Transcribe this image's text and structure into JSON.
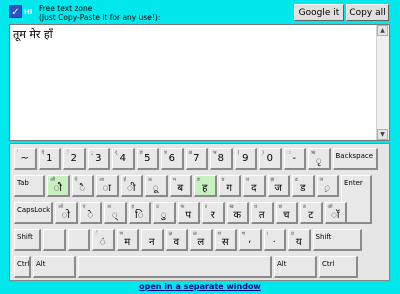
{
  "header": {
    "hi_label": "HI",
    "free_text_title": "Free text zone",
    "free_text_hint": "(Just Copy-Paste it for any use!):",
    "google_button": "Google it",
    "copy_button": "Copy all"
  },
  "editor": {
    "text": "तूम मेर हाँ"
  },
  "keyboard": {
    "rows": [
      [
        {
          "name": "key-grave",
          "sup": "'",
          "main": "~"
        },
        {
          "name": "key-1",
          "sup": "ऍ",
          "main": "1"
        },
        {
          "name": "key-2",
          "sup": "ॅ",
          "main": "2"
        },
        {
          "name": "key-3",
          "sup": "्र",
          "main": "3"
        },
        {
          "name": "key-4",
          "sup": "र्",
          "main": "4"
        },
        {
          "name": "key-5",
          "sup": "ज्ञ",
          "main": "5"
        },
        {
          "name": "key-6",
          "sup": "त्र",
          "main": "6"
        },
        {
          "name": "key-7",
          "sup": "क्ष",
          "main": "7"
        },
        {
          "name": "key-8",
          "sup": "श्र",
          "main": "8"
        },
        {
          "name": "key-9",
          "sup": "(",
          "main": "9"
        },
        {
          "name": "key-0",
          "sup": ")",
          "main": "0"
        },
        {
          "name": "key-minus",
          "sup": "ः",
          "main": "-"
        },
        {
          "name": "key-equals",
          "sup": "ऋ",
          "main": "ृ"
        },
        {
          "name": "key-backspace",
          "label": "Backspace"
        }
      ],
      [
        {
          "name": "key-tab",
          "label": "Tab"
        },
        {
          "name": "key-q",
          "sup": "औ",
          "main": "ौ",
          "hl": true
        },
        {
          "name": "key-w",
          "sup": "ऐ",
          "main": "ै"
        },
        {
          "name": "key-e",
          "sup": "आ",
          "main": "ा"
        },
        {
          "name": "key-r",
          "sup": "ई",
          "main": "ी"
        },
        {
          "name": "key-t",
          "sup": "ऊ",
          "main": "ू"
        },
        {
          "name": "key-y",
          "sup": "भ",
          "main": "ब"
        },
        {
          "name": "key-u",
          "sup": "ङ",
          "main": "ह",
          "hl": true
        },
        {
          "name": "key-i",
          "sup": "घ",
          "main": "ग"
        },
        {
          "name": "key-o",
          "sup": "ध",
          "main": "द"
        },
        {
          "name": "key-p",
          "sup": "झ",
          "main": "ज"
        },
        {
          "name": "key-bracket-left",
          "sup": "ढ",
          "main": "ड"
        },
        {
          "name": "key-bracket-right",
          "sup": "ञ",
          "main": "़"
        },
        {
          "name": "key-enter",
          "label": "Enter"
        }
      ],
      [
        {
          "name": "key-capslock",
          "label": "CapsLock"
        },
        {
          "name": "key-a",
          "sup": "ओ",
          "main": "ो"
        },
        {
          "name": "key-s",
          "sup": "ए",
          "main": "े"
        },
        {
          "name": "key-d",
          "sup": "अ",
          "main": "्"
        },
        {
          "name": "key-f",
          "sup": "इ",
          "main": "ि"
        },
        {
          "name": "key-g",
          "sup": "उ",
          "main": "ु"
        },
        {
          "name": "key-h",
          "sup": "फ",
          "main": "प"
        },
        {
          "name": "key-j",
          "sup": "ऱ",
          "main": "र"
        },
        {
          "name": "key-k",
          "sup": "ख",
          "main": "क"
        },
        {
          "name": "key-l",
          "sup": "थ",
          "main": "त"
        },
        {
          "name": "key-semicolon",
          "sup": "छ",
          "main": "च"
        },
        {
          "name": "key-quote",
          "sup": "ठ",
          "main": "ट"
        },
        {
          "name": "key-backslash",
          "sup": "ऑ",
          "main": "ॉ"
        }
      ],
      [
        {
          "name": "key-shift-left",
          "label": "Shift"
        },
        {
          "name": "key-extra1",
          "sup": "",
          "main": ""
        },
        {
          "name": "key-z",
          "sup": "",
          "main": ""
        },
        {
          "name": "key-x",
          "sup": "ँ",
          "main": "ं"
        },
        {
          "name": "key-c",
          "sup": "ण",
          "main": "म"
        },
        {
          "name": "key-v",
          "sup": "",
          "main": "न"
        },
        {
          "name": "key-b",
          "sup": "ऴ",
          "main": "व"
        },
        {
          "name": "key-n",
          "sup": "ळ",
          "main": "ल"
        },
        {
          "name": "key-m",
          "sup": "श",
          "main": "स"
        },
        {
          "name": "key-comma",
          "sup": "ष",
          "main": ","
        },
        {
          "name": "key-period",
          "sup": "।",
          "main": "."
        },
        {
          "name": "key-slash",
          "sup": "य़",
          "main": "य"
        },
        {
          "name": "key-shift-right",
          "label": "Shift"
        }
      ],
      [
        {
          "name": "key-ctrl-left",
          "label": "Ctrl"
        },
        {
          "name": "key-alt-left",
          "label": "Alt"
        },
        {
          "name": "key-space",
          "label": ""
        },
        {
          "name": "key-alt-right",
          "label": "Alt"
        },
        {
          "name": "key-ctrl-right",
          "label": "Ctrl"
        }
      ]
    ]
  },
  "footer": {
    "link": "open in a separate window"
  },
  "colors": {
    "background": "#00e8ec",
    "key_face": "#e8e8e8",
    "key_highlight": "#c8f0c0",
    "link": "#00008b"
  }
}
